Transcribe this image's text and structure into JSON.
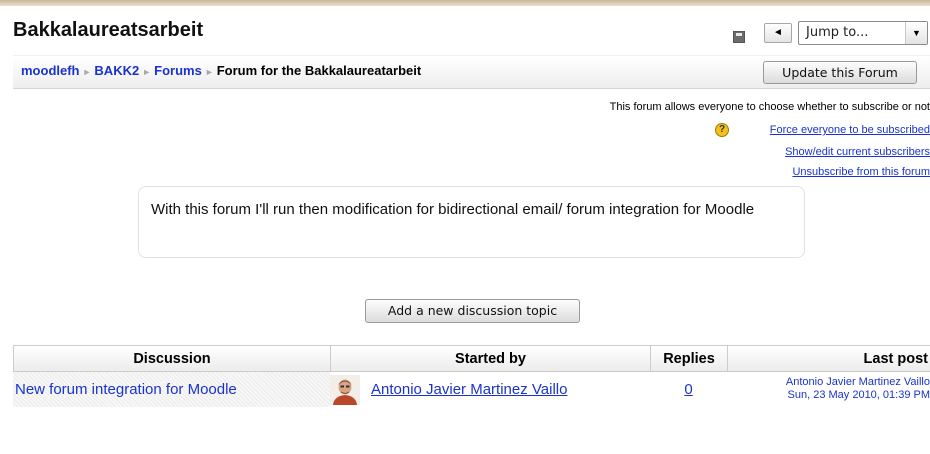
{
  "header": {
    "title": "Bakkalaureatsarbeit",
    "jump_prev_glyph": "◄",
    "jump_select_value": "Jump to...",
    "jump_dropdown_glyph": "▼"
  },
  "breadcrumb": {
    "items": [
      "moodlefh",
      "BAKK2",
      "Forums"
    ],
    "current": "Forum for the Bakkalaureatarbeit",
    "separator": "►"
  },
  "toolbar": {
    "update_forum_label": "Update this Forum"
  },
  "subscription": {
    "info": "This forum allows everyone to choose whether to subscribe or not",
    "force_link": "Force everyone to be subscribed",
    "show_edit_link": "Show/edit current subscribers",
    "unsubscribe_link": "Unsubscribe from this forum",
    "help_glyph": "?"
  },
  "intro": {
    "text": "With this forum I'll run then modification for bidirectional email/ forum integration for Moodle"
  },
  "actions": {
    "add_discussion_label": "Add a new discussion topic"
  },
  "table": {
    "headers": {
      "discussion": "Discussion",
      "started_by": "Started by",
      "replies": "Replies",
      "last_post": "Last post"
    },
    "rows": [
      {
        "discussion": "New forum integration for Moodle",
        "started_by": "Antonio Javier Martinez Vaillo",
        "replies": "0",
        "last_post_author": "Antonio Javier Martinez Vaillo",
        "last_post_date": "Sun, 23 May 2010, 01:39 PM"
      }
    ]
  },
  "icons": {
    "page_doc": "document-icon",
    "help": "help-icon",
    "avatar": "user-avatar"
  },
  "colors": {
    "link": "#1a33cc",
    "help_icon": "#f2c21a"
  }
}
